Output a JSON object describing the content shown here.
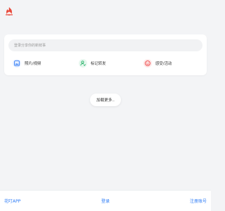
{
  "brand": {
    "logo_icon": "fire-logo-icon",
    "logo_color": "#e84a3c"
  },
  "composer": {
    "placeholder": "登录分享你的新鲜事",
    "actions": [
      {
        "label": "照片/视频",
        "icon": "image-icon",
        "color": "#2f7bf6",
        "bg": "#e8f0ff"
      },
      {
        "label": "标记转发",
        "icon": "user-tag-icon",
        "color": "#2bb36b",
        "bg": "#e6f7ee"
      },
      {
        "label": "感受/活动",
        "icon": "smile-icon",
        "color": "#ef4444",
        "bg": "#fde8e8"
      }
    ]
  },
  "feed": {
    "load_more_label": "加载更多.."
  },
  "footer": {
    "app_label": "花叮APP",
    "login_label": "登录",
    "register_label": "注册账号",
    "link_color": "#2d7cf6"
  }
}
